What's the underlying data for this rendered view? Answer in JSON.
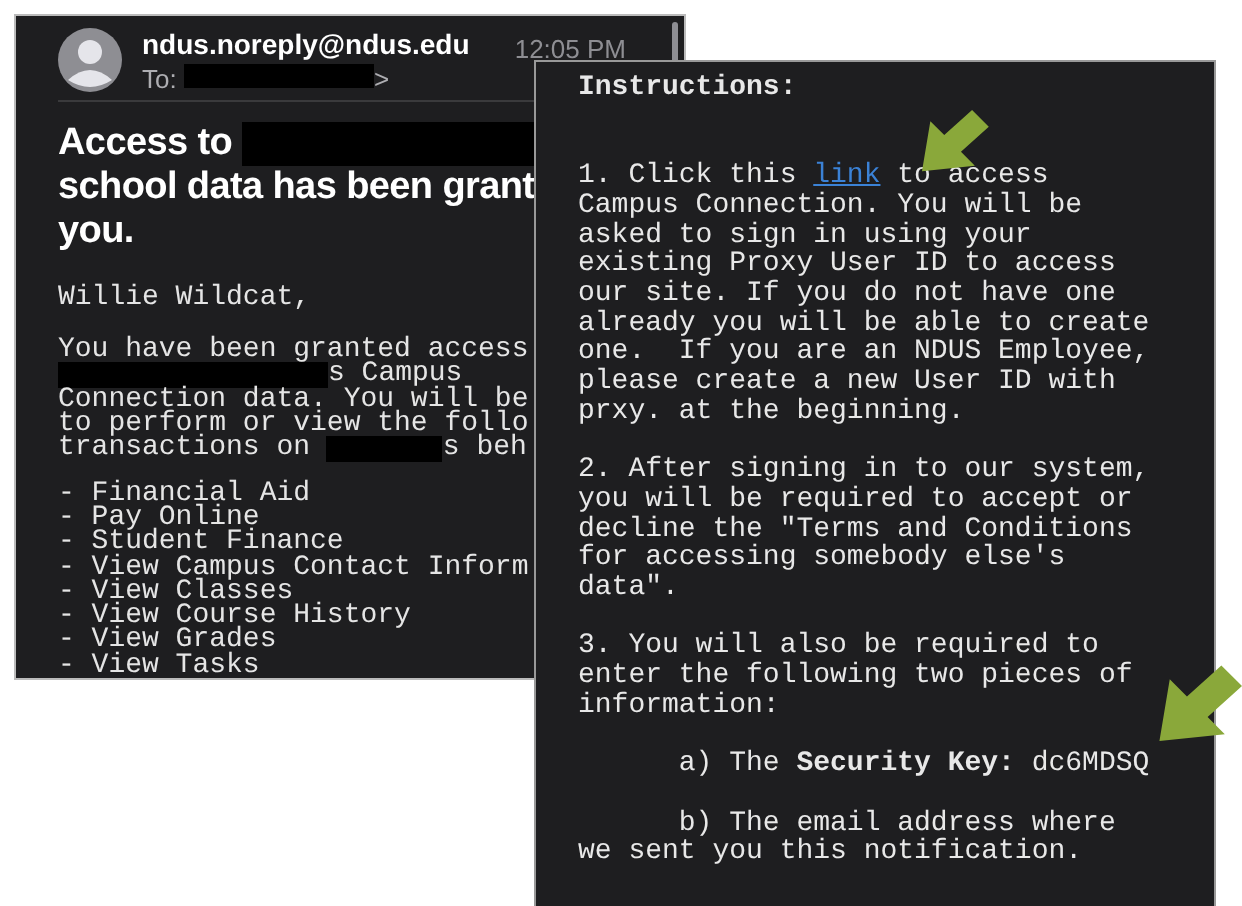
{
  "email_preview": {
    "sender": "ndus.noreply@ndus.edu",
    "to_line": [
      {
        "kind": "text",
        "text": "To: "
      },
      {
        "kind": "redaction"
      },
      {
        "kind": "text",
        "text": ">"
      }
    ],
    "time": "12:05 PM",
    "subject_lines": [
      [
        {
          "kind": "text",
          "text": "Access to "
        },
        {
          "kind": "redaction"
        }
      ],
      [
        {
          "kind": "text",
          "text": "school data has been grant"
        }
      ],
      [
        {
          "kind": "text",
          "text": "you."
        }
      ]
    ],
    "greeting": "Willie Wildcat,",
    "body_lines": [
      [
        {
          "kind": "text",
          "text": "You have been granted access"
        }
      ],
      [
        {
          "kind": "redaction"
        },
        {
          "kind": "text",
          "text": "s Campus"
        }
      ],
      [
        {
          "kind": "text",
          "text": "Connection data. You will be"
        }
      ],
      [
        {
          "kind": "text",
          "text": "to perform or view the follo"
        }
      ],
      [
        {
          "kind": "text",
          "text": "transactions on "
        },
        {
          "kind": "redaction"
        },
        {
          "kind": "text",
          "text": "s beh"
        }
      ]
    ],
    "list_items": [
      "- Financial Aid",
      "- Pay Online",
      "- Student Finance",
      "- View Campus Contact Inform",
      "- View Classes",
      "- View Course History",
      "- View Grades",
      "- View Tasks"
    ]
  },
  "instructions_panel": {
    "heading": "Instructions:",
    "steps": [
      {
        "kind": "link_paragraph",
        "before": "1. Click this ",
        "link": "link",
        "after": " to access Campus Connection. You will be asked to sign in using your existing Proxy User ID to access our site. If you do not have one already you will be able to create one.  If you are an NDUS Employee, please create a new User ID with prxy. at the beginning."
      },
      {
        "kind": "paragraph",
        "text": "2. After signing in to our system, you will be required to accept or decline the \"Terms and Conditions for accessing somebody else's data\"."
      },
      {
        "kind": "paragraph",
        "text": "3. You will also be required to enter the following two pieces of information:"
      },
      {
        "kind": "indented",
        "text": "a) The **Security Key:** dc6MDSQ"
      },
      {
        "kind": "indented",
        "text": "b) The email address where we sent you this notification."
      }
    ]
  }
}
